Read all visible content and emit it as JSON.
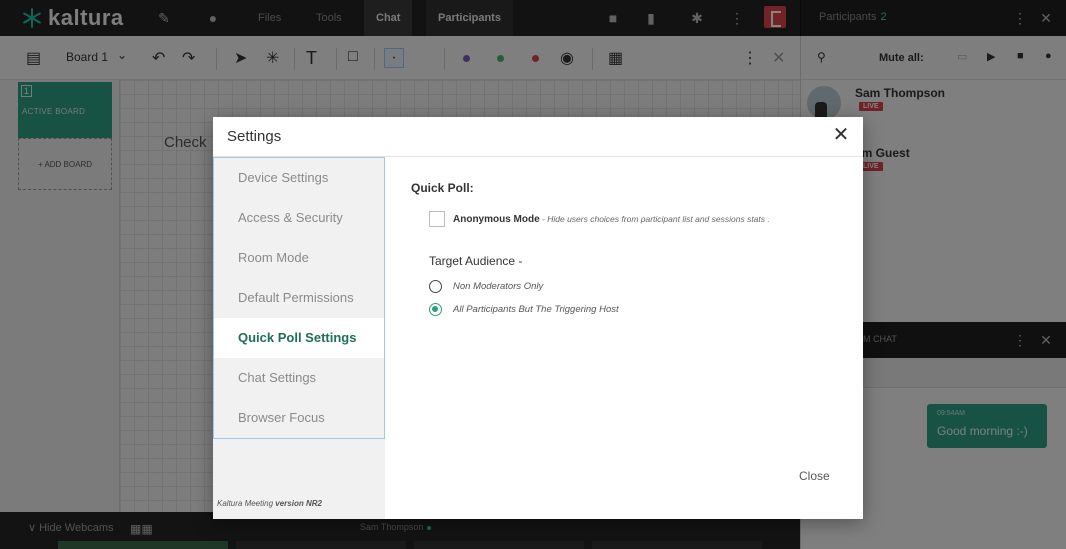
{
  "app": {
    "brand": "kaltura"
  },
  "topbar": {
    "tabs": [
      {
        "label": "Files"
      },
      {
        "label": "Tools"
      },
      {
        "label": "Chat"
      },
      {
        "label": "Participants"
      }
    ]
  },
  "participants_panel": {
    "title": "Participants",
    "count": "2",
    "mute_all_label": "Mute all:",
    "items": [
      {
        "name": "Sam Thompson",
        "badge": "LIVE"
      },
      {
        "name": "am Guest",
        "badge": "LIVE"
      }
    ]
  },
  "toolbar": {
    "board_label": "Board 1"
  },
  "boards": {
    "active_number": "1",
    "active_label": "ACTIVE BOARD",
    "add_label": "+ ADD BOARD"
  },
  "canvas": {
    "text": "Check"
  },
  "bottombar": {
    "hide_webcams": "∨ Hide Webcams",
    "presenter": "Sam Thompson"
  },
  "chat": {
    "title": "M CHAT",
    "message_time": "09:54AM",
    "message_text": "Good morning :-)"
  },
  "modal": {
    "title": "Settings",
    "nav_items": [
      {
        "label": "Device Settings"
      },
      {
        "label": "Access & Security"
      },
      {
        "label": "Room Mode"
      },
      {
        "label": "Default Permissions"
      },
      {
        "label": "Quick Poll Settings"
      },
      {
        "label": "Chat Settings"
      },
      {
        "label": "Browser Focus"
      }
    ],
    "active_nav_index": 4,
    "version_prefix": "Kaltura Meeting",
    "version_value": "version NR2",
    "content": {
      "section_title": "Quick Poll:",
      "anonymous_label": "Anonymous Mode",
      "anonymous_desc": " - Hide users choices from participant list and sessions stats .",
      "anonymous_checked": false,
      "target_label": "Target Audience -",
      "radio_options": [
        {
          "label": "Non Moderators Only",
          "checked": false
        },
        {
          "label": "All Participants But The Triggering Host",
          "checked": true
        }
      ]
    },
    "close_label": "Close"
  },
  "colors": {
    "accent": "#2e9e82",
    "live": "#d9434c",
    "nav_border": "#9fc7ea"
  }
}
